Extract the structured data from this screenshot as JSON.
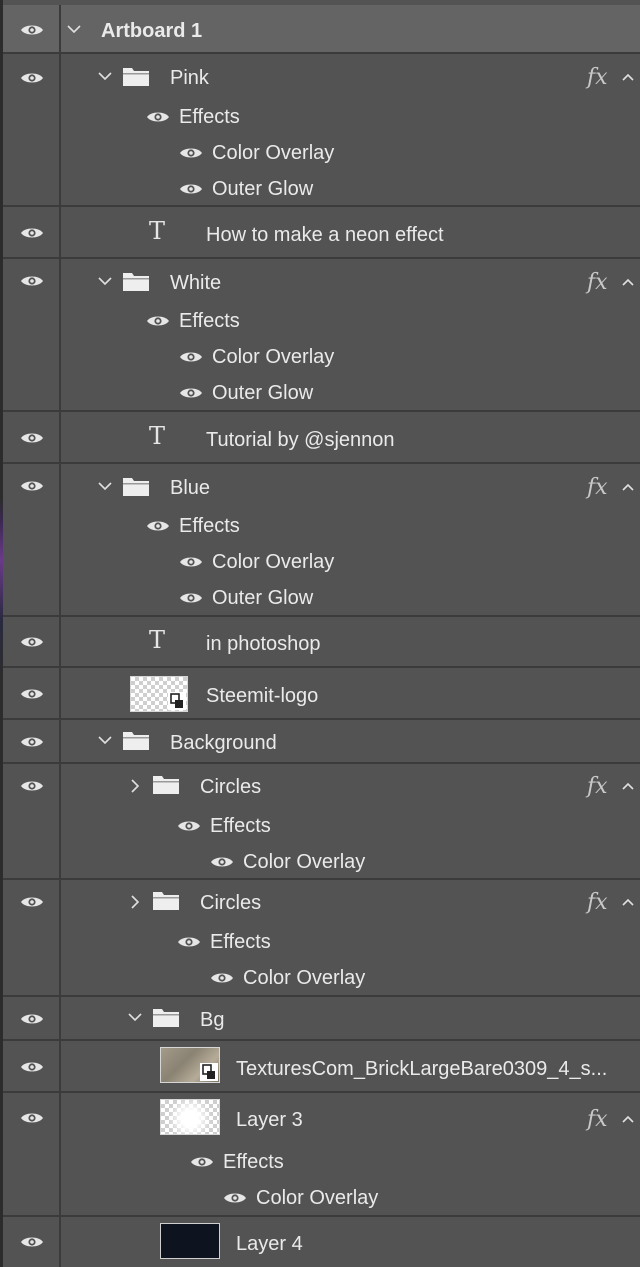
{
  "artboard": {
    "name": "Artboard 1"
  },
  "layers": {
    "pink": {
      "name": "Pink",
      "fx": "fx",
      "effects": "Effects",
      "effect1": "Color Overlay",
      "effect2": "Outer Glow"
    },
    "text1": {
      "name": "How to make a neon effect",
      "icon": "T"
    },
    "white": {
      "name": "White",
      "fx": "fx",
      "effects": "Effects",
      "effect1": "Color Overlay",
      "effect2": "Outer Glow"
    },
    "text2": {
      "name": "Tutorial by @sjennon",
      "icon": "T"
    },
    "blue": {
      "name": "Blue",
      "fx": "fx",
      "effects": "Effects",
      "effect1": "Color Overlay",
      "effect2": "Outer Glow"
    },
    "text3": {
      "name": "in photoshop",
      "icon": "T"
    },
    "steemit": {
      "name": "Steemit-logo"
    },
    "background": {
      "name": "Background"
    },
    "circles1": {
      "name": "Circles",
      "fx": "fx",
      "effects": "Effects",
      "effect1": "Color Overlay"
    },
    "circles2": {
      "name": "Circles",
      "fx": "fx",
      "effects": "Effects",
      "effect1": "Color Overlay"
    },
    "bg": {
      "name": "Bg"
    },
    "texture": {
      "name": "TexturesCom_BrickLargeBare0309_4_s..."
    },
    "layer3": {
      "name": "Layer 3",
      "fx": "fx",
      "effects": "Effects",
      "effect1": "Color Overlay"
    },
    "layer4": {
      "name": "Layer 4"
    }
  },
  "icons": {
    "visibility": "eye-icon",
    "group": "folder-icon",
    "text": "text-layer-icon",
    "expanded": "chevron-down-icon",
    "collapsed": "chevron-right-icon",
    "smart_object": "smart-object-icon"
  },
  "colors": {
    "panel_bg": "#535353",
    "artboard_bg": "#646464",
    "divider": "#3b3b3b",
    "text": "#eaeaea"
  }
}
